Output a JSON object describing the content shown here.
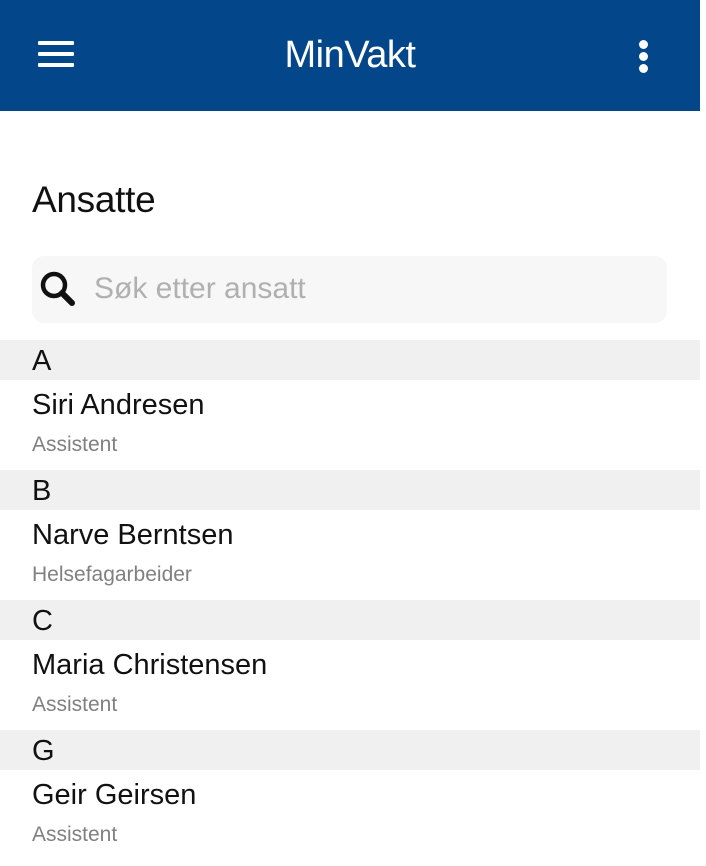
{
  "appbar": {
    "title": "MinVakt",
    "menu_icon": "hamburger-menu-icon",
    "more_icon": "more-vertical-icon",
    "color": "#04468a"
  },
  "page": {
    "title": "Ansatte"
  },
  "search": {
    "placeholder": "Søk etter ansatt",
    "value": "",
    "icon": "search-icon"
  },
  "sections": [
    {
      "letter": "A",
      "employees": [
        {
          "name": "Siri Andresen",
          "role": "Assistent"
        }
      ]
    },
    {
      "letter": "B",
      "employees": [
        {
          "name": "Narve Berntsen",
          "role": "Helsefagarbeider"
        }
      ]
    },
    {
      "letter": "C",
      "employees": [
        {
          "name": "Maria Christensen",
          "role": "Assistent"
        }
      ]
    },
    {
      "letter": "G",
      "employees": [
        {
          "name": "Geir Geirsen",
          "role": "Assistent"
        }
      ]
    }
  ]
}
